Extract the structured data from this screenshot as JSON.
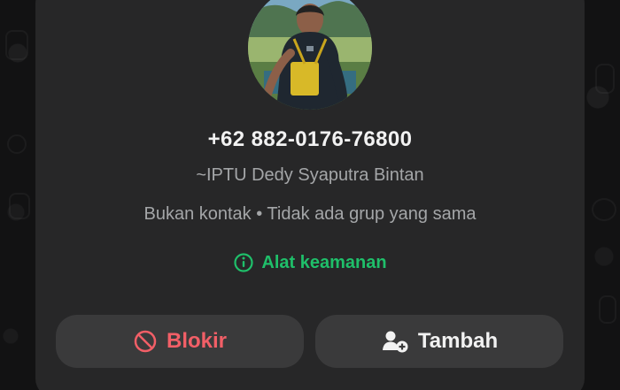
{
  "contact": {
    "phone_number": "+62 882-0176-76800",
    "push_name": "~IPTU Dedy Syaputra Bintan",
    "status_line": "Bukan kontak • Tidak ada grup yang sama"
  },
  "security": {
    "label": "Alat keamanan",
    "icon": "info-circle-icon",
    "color": "#1fbf6a"
  },
  "actions": {
    "block_label": "Blokir",
    "block_icon": "block-icon",
    "block_color": "#f25f67",
    "add_label": "Tambah",
    "add_icon": "add-contact-icon"
  },
  "colors": {
    "card": "#272728",
    "button": "#3a3a3b",
    "secondary_text": "#a4a6a8"
  }
}
